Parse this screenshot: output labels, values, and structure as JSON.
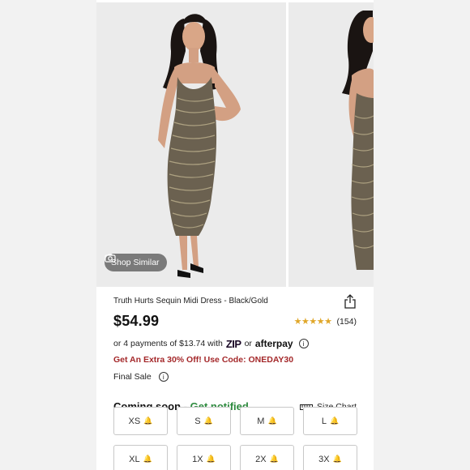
{
  "gallery": {
    "shop_similar_label": "Shop Similar"
  },
  "product": {
    "title": "Truth Hurts Sequin Midi Dress - Black/Gold",
    "price": "$54.99",
    "rating": {
      "stars": 4.5,
      "count": "(154)"
    },
    "installments": {
      "prefix": "or 4 payments of $13.74 with",
      "zip": "ZIP",
      "or": "or",
      "afterpay": "afterpay"
    },
    "promo": "Get An Extra 30% Off! Use Code: ONEDAY30",
    "final_sale": "Final Sale"
  },
  "availability": {
    "coming_soon": "Coming soon - ",
    "get_notified": "Get notified",
    "size_chart": "Size Chart"
  },
  "sizes": [
    "XS",
    "S",
    "M",
    "L",
    "XL",
    "1X",
    "2X",
    "3X"
  ],
  "colors": {
    "promo": "#a4282a",
    "notify": "#2d8a3e",
    "star": "#e0a72a"
  }
}
